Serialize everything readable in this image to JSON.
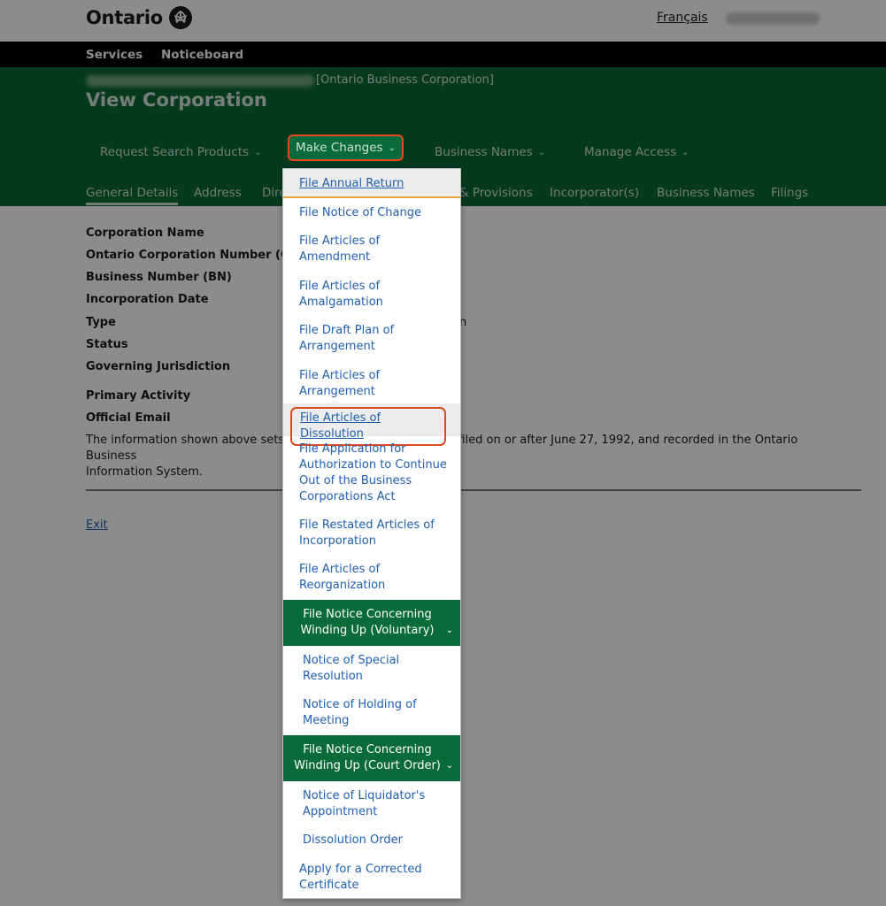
{
  "header": {
    "logo_text": "Ontario",
    "language_link": "Français"
  },
  "top_nav": {
    "items": [
      "Services",
      "Noticeboard"
    ]
  },
  "corp_header": {
    "corp_type": "[Ontario Business Corporation]",
    "page_title": "View Corporation"
  },
  "main_menu": {
    "items": [
      {
        "label": "Request Search Products"
      },
      {
        "label": "Make Changes"
      },
      {
        "label": "Business Names"
      },
      {
        "label": "Manage Access"
      }
    ]
  },
  "tabs": {
    "items": [
      "General Details",
      "Address",
      "Dire",
      "& Provisions",
      "Incorporator(s)",
      "Business Names",
      "Filings"
    ]
  },
  "details": {
    "labels": [
      "Corporation Name",
      "Ontario Corporation Number (OCN",
      "Business Number (BN)",
      "Incorporation Date",
      "Type",
      "Status",
      "Governing Jurisdiction",
      "Primary Activity",
      "Official Email"
    ],
    "type_value_fragment": "n",
    "info_text_left": "The information shown above sets c",
    "info_text_right": "filed on or after June 27, 1992, and recorded in the Ontario Business",
    "info_text_line2": "Information System.",
    "exit_label": "Exit"
  },
  "dropdown": {
    "items": [
      "File Annual Return",
      "File Notice of Change",
      "File Articles of Amendment",
      "File Articles of Amalgamation",
      "File Draft Plan of Arrangement",
      "File Articles of Arrangement",
      "File Articles of Dissolution",
      "File Application for Authorization to Continue Out of the Business Corporations Act",
      "File Restated Articles of Incorporation",
      "File Articles of Reorganization"
    ],
    "voluntary_group": {
      "heading": "File Notice Concerning Winding Up (Voluntary)",
      "items": [
        "Notice of Special Resolution",
        "Notice of Holding of Meeting"
      ]
    },
    "court_group": {
      "heading": "File Notice Concerning Winding Up (Court Order)",
      "items": [
        "Notice of Liquidator's Appointment",
        "Dissolution Order"
      ]
    },
    "last_item": "Apply for a Corrected Certificate"
  },
  "icons": {
    "logo": "trillium-icon",
    "chevron": "chevron-down-icon"
  },
  "colors": {
    "brand_green": "#0a6b3a",
    "link_blue": "#1f5fb0",
    "highlight_red": "#e0481f",
    "focus_orange": "#e8a23a"
  }
}
